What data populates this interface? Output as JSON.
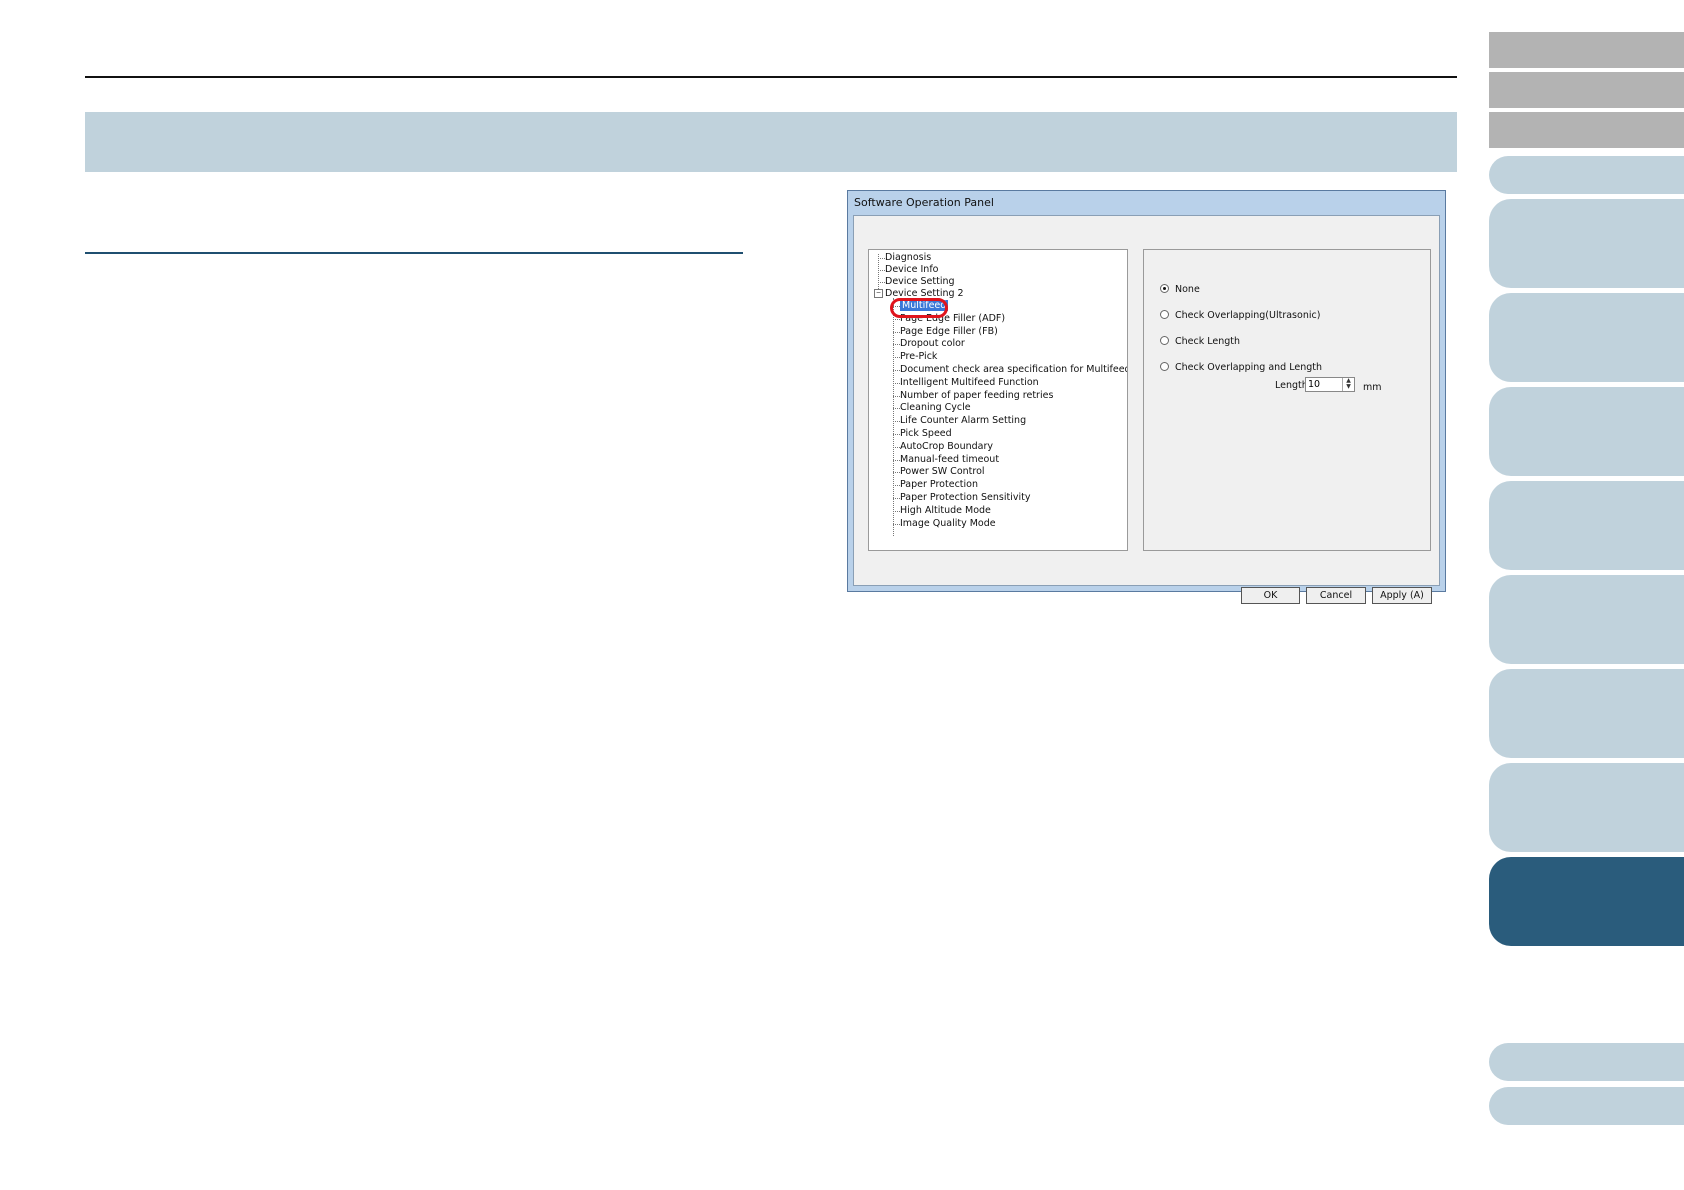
{
  "dialog": {
    "title": "Software Operation Panel",
    "tree": {
      "top_items": [
        "Diagnosis",
        "Device Info",
        "Device Setting",
        "Device Setting 2"
      ],
      "expander": "−",
      "sub_items": [
        "Multifeed",
        "Page Edge Filler (ADF)",
        "Page Edge Filler (FB)",
        "Dropout color",
        "Pre-Pick",
        "Document check area specification for Multifeed Detection",
        "Intelligent Multifeed Function",
        "Number of paper feeding retries",
        "Cleaning Cycle",
        "Life Counter Alarm Setting",
        "Pick Speed",
        "AutoCrop Boundary",
        "Manual-feed timeout",
        "Power SW Control",
        "Paper Protection",
        "Paper Protection Sensitivity",
        "High Altitude Mode",
        "Image Quality Mode"
      ],
      "selected": "Multifeed"
    },
    "options": {
      "radios": [
        {
          "label": "None",
          "selected": true
        },
        {
          "label": "Check Overlapping(Ultrasonic)",
          "selected": false
        },
        {
          "label": "Check Length",
          "selected": false
        },
        {
          "label": "Check Overlapping and Length",
          "selected": false
        }
      ],
      "length_label": "Length",
      "length_value": "10",
      "length_unit": "mm"
    },
    "buttons": {
      "ok": "OK",
      "cancel": "Cancel",
      "apply": "Apply (A)"
    }
  },
  "colors": {
    "header_band": "#c0d2dc",
    "nav_light": "#c0d2dc",
    "nav_active": "#2a5c7c",
    "nav_gray": "#b3b3b3",
    "highlight": "#e0141c"
  }
}
